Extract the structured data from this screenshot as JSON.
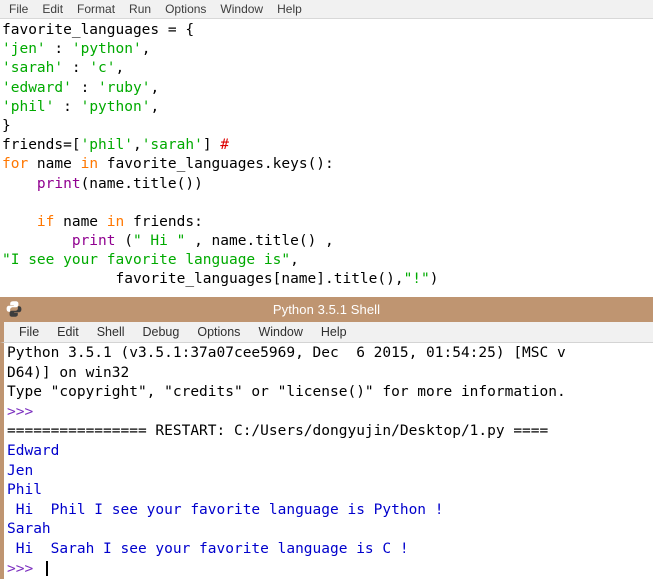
{
  "editor": {
    "menu": [
      {
        "label": "File",
        "name": "editor-menu-file"
      },
      {
        "label": "Edit",
        "name": "editor-menu-edit"
      },
      {
        "label": "Format",
        "name": "editor-menu-format"
      },
      {
        "label": "Run",
        "name": "editor-menu-run"
      },
      {
        "label": "Options",
        "name": "editor-menu-options"
      },
      {
        "label": "Window",
        "name": "editor-menu-window"
      },
      {
        "label": "Help",
        "name": "editor-menu-help"
      }
    ],
    "code_lines": [
      {
        "line": 1,
        "segments": [
          {
            "t": "favorite_languages = {",
            "c": "def"
          }
        ]
      },
      {
        "line": 2,
        "segments": [
          {
            "t": "'jen'",
            "c": "str"
          },
          {
            "t": " : ",
            "c": "def"
          },
          {
            "t": "'python'",
            "c": "str"
          },
          {
            "t": ",",
            "c": "def"
          }
        ]
      },
      {
        "line": 3,
        "segments": [
          {
            "t": "'sarah'",
            "c": "str"
          },
          {
            "t": " : ",
            "c": "def"
          },
          {
            "t": "'c'",
            "c": "str"
          },
          {
            "t": ",",
            "c": "def"
          }
        ]
      },
      {
        "line": 4,
        "segments": [
          {
            "t": "'edward'",
            "c": "str"
          },
          {
            "t": " : ",
            "c": "def"
          },
          {
            "t": "'ruby'",
            "c": "str"
          },
          {
            "t": ",",
            "c": "def"
          }
        ]
      },
      {
        "line": 5,
        "segments": [
          {
            "t": "'phil'",
            "c": "str"
          },
          {
            "t": " : ",
            "c": "def"
          },
          {
            "t": "'python'",
            "c": "str"
          },
          {
            "t": ",",
            "c": "def"
          }
        ]
      },
      {
        "line": 6,
        "segments": [
          {
            "t": "}",
            "c": "def"
          }
        ]
      },
      {
        "line": 7,
        "segments": [
          {
            "t": "friends=[",
            "c": "def"
          },
          {
            "t": "'phil'",
            "c": "str"
          },
          {
            "t": ",",
            "c": "def"
          },
          {
            "t": "'sarah'",
            "c": "str"
          },
          {
            "t": "] ",
            "c": "def"
          },
          {
            "t": "#",
            "c": "cmt"
          }
        ]
      },
      {
        "line": 8,
        "segments": [
          {
            "t": "for",
            "c": "kw"
          },
          {
            "t": " name ",
            "c": "def"
          },
          {
            "t": "in",
            "c": "kw"
          },
          {
            "t": " favorite_languages.keys():",
            "c": "def"
          }
        ]
      },
      {
        "line": 9,
        "segments": [
          {
            "t": "    ",
            "c": "def"
          },
          {
            "t": "print",
            "c": "bi"
          },
          {
            "t": "(name.title())",
            "c": "def"
          }
        ]
      },
      {
        "line": 10,
        "segments": [
          {
            "t": "",
            "c": "def"
          }
        ]
      },
      {
        "line": 11,
        "segments": [
          {
            "t": "    ",
            "c": "def"
          },
          {
            "t": "if",
            "c": "kw"
          },
          {
            "t": " name ",
            "c": "def"
          },
          {
            "t": "in",
            "c": "kw"
          },
          {
            "t": " friends:",
            "c": "def"
          }
        ]
      },
      {
        "line": 12,
        "segments": [
          {
            "t": "        ",
            "c": "def"
          },
          {
            "t": "print",
            "c": "bi"
          },
          {
            "t": " (",
            "c": "def"
          },
          {
            "t": "\" Hi \"",
            "c": "str"
          },
          {
            "t": " , name.title() ,",
            "c": "def"
          }
        ]
      },
      {
        "line": 13,
        "segments": [
          {
            "t": "\"I see your favorite language is\"",
            "c": "str"
          },
          {
            "t": ",",
            "c": "def"
          }
        ]
      },
      {
        "line": 14,
        "segments": [
          {
            "t": "             favorite_languages[name].title(),",
            "c": "def"
          },
          {
            "t": "\"!\"",
            "c": "str"
          },
          {
            "t": ")",
            "c": "def"
          }
        ]
      }
    ]
  },
  "shell": {
    "title": "Python 3.5.1 Shell",
    "title_icon": "python-logo-icon",
    "menu": [
      {
        "label": "File",
        "name": "shell-menu-file"
      },
      {
        "label": "Edit",
        "name": "shell-menu-edit"
      },
      {
        "label": "Shell",
        "name": "shell-menu-shell"
      },
      {
        "label": "Debug",
        "name": "shell-menu-debug"
      },
      {
        "label": "Options",
        "name": "shell-menu-options"
      },
      {
        "label": "Window",
        "name": "shell-menu-window"
      },
      {
        "label": "Help",
        "name": "shell-menu-help"
      }
    ],
    "output_lines": [
      {
        "text": "Python 3.5.1 (v3.5.1:37a07cee5969, Dec  6 2015, 01:54:25) [MSC v",
        "kind": "plain"
      },
      {
        "text": "D64)] on win32",
        "kind": "plain"
      },
      {
        "text": "Type \"copyright\", \"credits\" or \"license()\" for more information.",
        "kind": "plain"
      },
      {
        "text": ">>> ",
        "kind": "prompt"
      },
      {
        "text": "================ RESTART: C:/Users/dongyujin/Desktop/1.py ====",
        "kind": "restart"
      },
      {
        "text": "Edward",
        "kind": "out"
      },
      {
        "text": "Jen",
        "kind": "out"
      },
      {
        "text": "Phil",
        "kind": "out"
      },
      {
        "text": " Hi  Phil I see your favorite language is Python !",
        "kind": "out"
      },
      {
        "text": "Sarah",
        "kind": "out"
      },
      {
        "text": " Hi  Sarah I see your favorite language is C !",
        "kind": "out"
      },
      {
        "text": ">>> ",
        "kind": "prompt-cursor"
      }
    ]
  },
  "colors": {
    "titlebar": "#bf9571",
    "menubar": "#f1f1f1",
    "string": "#00aa00",
    "keyword": "#ff7700",
    "builtin": "#900090",
    "comment": "#dd0000",
    "shell_output": "#0000cc",
    "shell_prompt": "#7b2fbf"
  }
}
